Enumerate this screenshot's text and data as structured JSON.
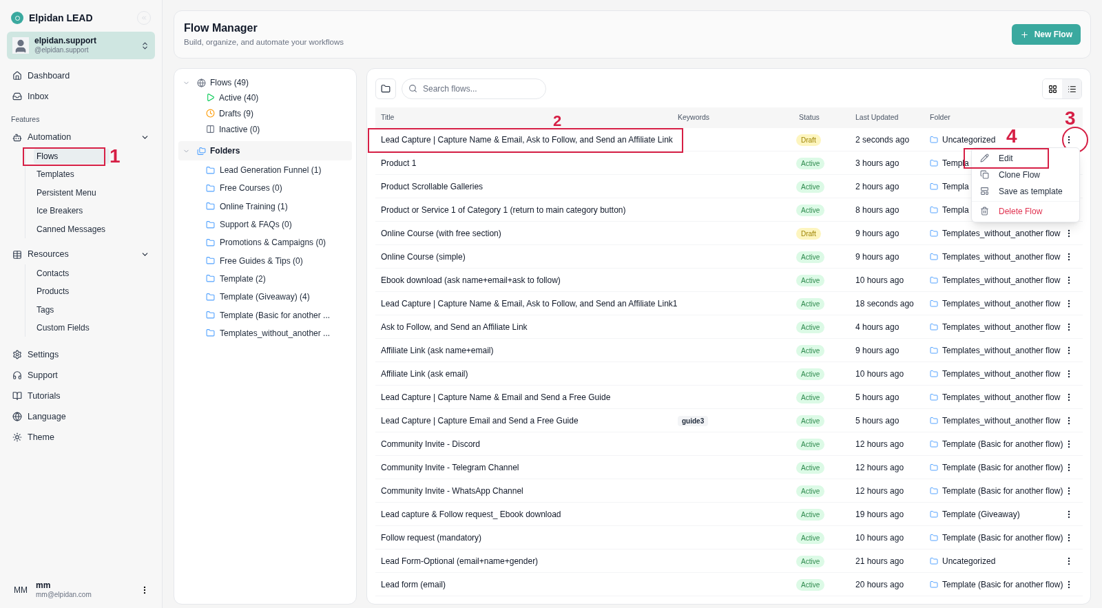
{
  "brand": {
    "name": "Elpidan LEAD"
  },
  "account": {
    "name": "elpidan.support",
    "handle": "@elpidan.support"
  },
  "nav_top": [
    {
      "label": "Dashboard"
    },
    {
      "label": "Inbox"
    }
  ],
  "features_heading": "Features",
  "groups": [
    {
      "label": "Automation",
      "expanded": true,
      "children": [
        {
          "label": "Flows",
          "selected": true,
          "callout": "1"
        },
        {
          "label": "Templates",
          "selected": false
        },
        {
          "label": "Persistent Menu",
          "selected": false
        },
        {
          "label": "Ice Breakers",
          "selected": false
        },
        {
          "label": "Canned Messages",
          "selected": false
        }
      ]
    },
    {
      "label": "Resources",
      "expanded": true,
      "children": [
        {
          "label": "Contacts",
          "selected": false
        },
        {
          "label": "Products",
          "selected": false
        },
        {
          "label": "Tags",
          "selected": false
        },
        {
          "label": "Custom Fields",
          "selected": false
        }
      ]
    }
  ],
  "nav_bottom": [
    {
      "label": "Settings"
    },
    {
      "label": "Support"
    },
    {
      "label": "Tutorials"
    },
    {
      "label": "Language"
    },
    {
      "label": "Theme"
    }
  ],
  "user": {
    "initials": "MM",
    "name": "mm",
    "email": "mm@elpidan.com"
  },
  "header": {
    "title": "Flow Manager",
    "subtitle": "Build, organize, and automate your workflows",
    "new_button": "New Flow"
  },
  "flows_tree": {
    "label": "Flows (49)",
    "expanded": true,
    "children": [
      {
        "label": "Active (40)",
        "kind": "active"
      },
      {
        "label": "Drafts (9)",
        "kind": "draft"
      },
      {
        "label": "Inactive (0)",
        "kind": "inactive"
      }
    ]
  },
  "folders_tree": {
    "label": "Folders",
    "expanded": true,
    "children": [
      {
        "label": "Lead Generation Funnel (1)"
      },
      {
        "label": "Free Courses (0)"
      },
      {
        "label": "Online Training (1)"
      },
      {
        "label": "Support & FAQs (0)"
      },
      {
        "label": "Promotions & Campaigns (0)"
      },
      {
        "label": "Free Guides & Tips (0)"
      },
      {
        "label": "Template (2)"
      },
      {
        "label": "Template (Giveaway) (4)"
      },
      {
        "label": "Template (Basic for another ..."
      },
      {
        "label": "Templates_without_another ..."
      }
    ]
  },
  "search": {
    "placeholder": "Search flows..."
  },
  "view_toggle": [
    {
      "kind": "grid",
      "selected": false
    },
    {
      "kind": "list",
      "selected": true
    }
  ],
  "table": {
    "columns": [
      "Title",
      "Keywords",
      "Status",
      "Last Updated",
      "Folder"
    ],
    "rows": [
      {
        "title": "Lead Capture | Capture Name & Email, Ask to Follow, and Send an Affiliate Link",
        "title_callout": "2",
        "status": {
          "label": "Draft",
          "kind": "draft"
        },
        "updated": "2 seconds ago",
        "folder": "Uncategorized",
        "menu_callout": "3"
      },
      {
        "title": "Product 1",
        "status": {
          "label": "Active",
          "kind": "active"
        },
        "updated": "3 hours ago",
        "folder": "Templa"
      },
      {
        "title": "Product Scrollable Galleries",
        "status": {
          "label": "Active",
          "kind": "active"
        },
        "updated": "2 hours ago",
        "folder": "Templa"
      },
      {
        "title": "Product or Service 1 of Category 1 (return to main category button)",
        "status": {
          "label": "Active",
          "kind": "active"
        },
        "updated": "8 hours ago",
        "folder": "Templa"
      },
      {
        "title": "Online Course (with free section)",
        "status": {
          "label": "Draft",
          "kind": "draft"
        },
        "updated": "9 hours ago",
        "folder": "Templates_without_another flow"
      },
      {
        "title": "Online Course (simple)",
        "status": {
          "label": "Active",
          "kind": "active"
        },
        "updated": "9 hours ago",
        "folder": "Templates_without_another flow"
      },
      {
        "title": "Ebook download (ask name+email+ask to follow)",
        "status": {
          "label": "Active",
          "kind": "active"
        },
        "updated": "10 hours ago",
        "folder": "Templates_without_another flow"
      },
      {
        "title": "Lead Capture | Capture Name & Email, Ask to Follow, and Send an Affiliate Link1",
        "status": {
          "label": "Active",
          "kind": "active"
        },
        "updated": "18 seconds ago",
        "folder": "Templates_without_another flow"
      },
      {
        "title": "Ask to Follow, and Send an Affiliate Link",
        "status": {
          "label": "Active",
          "kind": "active"
        },
        "updated": "4 hours ago",
        "folder": "Templates_without_another flow"
      },
      {
        "title": "Affiliate Link (ask name+email)",
        "status": {
          "label": "Active",
          "kind": "active"
        },
        "updated": "9 hours ago",
        "folder": "Templates_without_another flow"
      },
      {
        "title": "Affiliate Link (ask email)",
        "status": {
          "label": "Active",
          "kind": "active"
        },
        "updated": "10 hours ago",
        "folder": "Templates_without_another flow"
      },
      {
        "title": "Lead Capture | Capture Name & Email and Send a Free Guide",
        "status": {
          "label": "Active",
          "kind": "active"
        },
        "updated": "5 hours ago",
        "folder": "Templates_without_another flow"
      },
      {
        "title": "Lead Capture | Capture Email and Send a Free Guide",
        "keywords": [
          "guide3"
        ],
        "status": {
          "label": "Active",
          "kind": "active"
        },
        "updated": "5 hours ago",
        "folder": "Templates_without_another flow"
      },
      {
        "title": "Community Invite - Discord",
        "status": {
          "label": "Active",
          "kind": "active"
        },
        "updated": "12 hours ago",
        "folder": "Template (Basic for another flow)"
      },
      {
        "title": "Community Invite - Telegram Channel",
        "status": {
          "label": "Active",
          "kind": "active"
        },
        "updated": "12 hours ago",
        "folder": "Template (Basic for another flow)"
      },
      {
        "title": "Community Invite - WhatsApp Channel",
        "status": {
          "label": "Active",
          "kind": "active"
        },
        "updated": "12 hours ago",
        "folder": "Template (Basic for another flow)"
      },
      {
        "title": "Lead capture & Follow request_ Ebook download",
        "status": {
          "label": "Active",
          "kind": "active"
        },
        "updated": "19 hours ago",
        "folder": "Template (Giveaway)"
      },
      {
        "title": "Follow request (mandatory)",
        "status": {
          "label": "Active",
          "kind": "active"
        },
        "updated": "10 hours ago",
        "folder": "Template (Basic for another flow)"
      },
      {
        "title": "Lead Form-Optional (email+name+gender)",
        "status": {
          "label": "Active",
          "kind": "active"
        },
        "updated": "21 hours ago",
        "folder": "Uncategorized"
      },
      {
        "title": "Lead form (email)",
        "status": {
          "label": "Active",
          "kind": "active"
        },
        "updated": "20 hours ago",
        "folder": "Template (Basic for another flow)"
      }
    ]
  },
  "context_menu": {
    "items": [
      {
        "label": "Edit",
        "kind": "edit",
        "callout": "4"
      },
      {
        "label": "Clone Flow",
        "kind": "clone"
      },
      {
        "label": "Save as template",
        "kind": "template"
      },
      {
        "label": "Delete Flow",
        "kind": "delete"
      }
    ]
  }
}
